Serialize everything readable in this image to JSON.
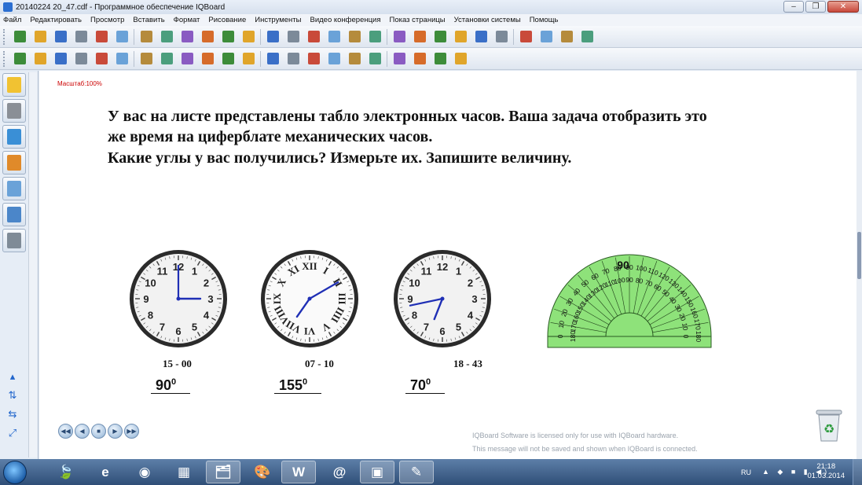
{
  "window": {
    "title": "20140224 20_47.cdf - Программное обеспечение IQBoard",
    "minimize": "–",
    "maximize": "❐",
    "close": "✕"
  },
  "menu": [
    "Файл",
    "Редактировать",
    "Просмотр",
    "Вставить",
    "Формат",
    "Рисование",
    "Инструменты",
    "Видео конференция",
    "Показ страницы",
    "Установки системы",
    "Помощь"
  ],
  "toolbar1": [
    "new-page-icon",
    "open-folder-icon",
    "save-icon",
    "page-icon",
    "delete-page-icon",
    "copy-icon",
    "cut-icon",
    "paste-icon",
    "zoom-in-icon",
    "zoom-out-icon",
    "zoom-select-icon",
    "fit-icon",
    "hand-icon",
    "screenshot-icon",
    "fullscreen-icon",
    "dual-page-icon",
    "magic-pen-icon",
    "eraser-icon",
    "spotlight-icon",
    "screen-shade-icon",
    "back-icon",
    "desktop-icon",
    "camera-icon",
    "recorder-icon",
    "robot-icon",
    "keyboard-icon",
    "monitor-icon",
    "grid-icon"
  ],
  "toolbar2": [
    "select-arrow-icon",
    "mouse-icon",
    "pointer-icon",
    "laser-icon",
    "pen-icon",
    "brush-icon",
    "pencil-icon",
    "calligraphy-icon",
    "highlighter-icon",
    "smart-pen-icon",
    "eraser-icon",
    "line-icon",
    "shape-icon",
    "chart-icon",
    "triangle-icon",
    "color-wheel-icon",
    "table-icon",
    "note-icon",
    "text-icon",
    "fill-icon",
    "ruler-icon",
    "palette-icon"
  ],
  "sidebar": {
    "tabs": [
      "page-sort-icon",
      "library-icon",
      "gallery-icon",
      "resource-icon",
      "tools-icon",
      "books-icon",
      "notes-icon"
    ],
    "nav": [
      "▴",
      "⇅",
      "⇆",
      "⤢"
    ]
  },
  "canvas": {
    "zoom": "Масштаб:100%",
    "task_lines": [
      "У вас на листе представлены табло электронных часов. Ваша задача отобразить это",
      "же время на циферблате механических часов.",
      " Какие углы у вас получились? Измерьте их. Запишите величину."
    ],
    "clocks": [
      {
        "time": "15 - 00",
        "angle": "90",
        "degree": "0",
        "numerals": "arabic",
        "hour": 3,
        "minute": 0
      },
      {
        "time": "07 - 10",
        "angle": "155",
        "degree": "0",
        "numerals": "roman",
        "hour": 7,
        "minute": 10
      },
      {
        "time": "18 - 43",
        "angle": "70",
        "degree": "0",
        "numerals": "arabic",
        "hour": 6,
        "minute": 43
      }
    ],
    "arabic_numerals": [
      "12",
      "1",
      "2",
      "3",
      "4",
      "5",
      "6",
      "7",
      "8",
      "9",
      "10",
      "11"
    ],
    "roman_numerals": [
      "XII",
      "I",
      "II",
      "III",
      "IIII",
      "V",
      "VI",
      "VII",
      "VIII",
      "IX",
      "X",
      "XI"
    ],
    "protractor": {
      "center_label": "90",
      "ticks": [
        "0",
        "10",
        "20",
        "30",
        "40",
        "50",
        "60",
        "70",
        "80",
        "90",
        "100",
        "110",
        "120",
        "130",
        "140",
        "150",
        "160",
        "170",
        "180"
      ],
      "color": "#8ee27a"
    },
    "playback": [
      "◀◀",
      "◀",
      "■",
      "▶",
      "▶▶"
    ],
    "watermark": [
      "IQBoard Software is licensed only for use with IQBoard hardware.",
      "This message will not be saved and shown when IQBoard is connected."
    ]
  },
  "taskbar": {
    "apps": [
      {
        "icon": "🍃",
        "name": "leaf-app-icon"
      },
      {
        "icon": "e",
        "name": "ie-icon"
      },
      {
        "icon": "◉",
        "name": "network-app-icon"
      },
      {
        "icon": "▦",
        "name": "calculator-icon"
      },
      {
        "icon": "🗂",
        "name": "explorer-icon"
      },
      {
        "icon": "🎨",
        "name": "paint-icon"
      },
      {
        "icon": "W",
        "name": "word-icon"
      },
      {
        "icon": "@",
        "name": "mail-icon"
      },
      {
        "icon": "▣",
        "name": "screen-icon"
      },
      {
        "icon": "✎",
        "name": "iqboard-icon"
      }
    ],
    "lang": "RU",
    "time": "21:18",
    "date": "01.03.2014"
  }
}
